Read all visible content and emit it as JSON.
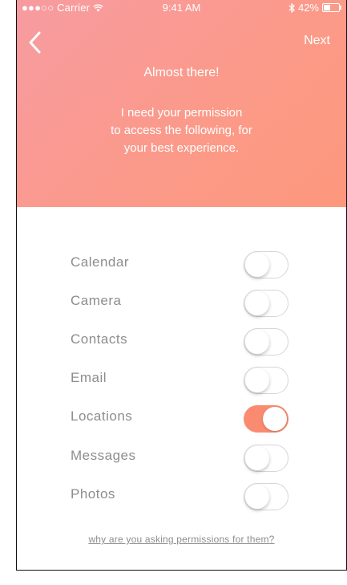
{
  "status_bar": {
    "signal": "●●●○○",
    "carrier": "Carrier",
    "time": "9:41 AM",
    "battery": "42%",
    "battery_level": 0.42
  },
  "nav": {
    "next_label": "Next"
  },
  "header": {
    "title": "Almost there!",
    "message_line1": "I need your permission",
    "message_line2": "to access the following, for",
    "message_line3": "your best experience."
  },
  "permissions": [
    {
      "label": "Calendar",
      "enabled": false
    },
    {
      "label": "Camera",
      "enabled": false
    },
    {
      "label": "Contacts",
      "enabled": false
    },
    {
      "label": "Email",
      "enabled": false
    },
    {
      "label": "Locations",
      "enabled": true
    },
    {
      "label": "Messages",
      "enabled": false
    },
    {
      "label": "Photos",
      "enabled": false
    }
  ],
  "footer": {
    "why_link": "why are you asking permissions for them?"
  },
  "colors": {
    "header_gradient_start": "#f79ba1",
    "header_gradient_end": "#fd987c",
    "toggle_on": "#fb8b70",
    "label_gray": "#8d8d8d"
  },
  "icons": {
    "back": "chevron-left-icon",
    "wifi": "wifi-icon",
    "bluetooth": "bluetooth-icon",
    "battery": "battery-icon"
  }
}
